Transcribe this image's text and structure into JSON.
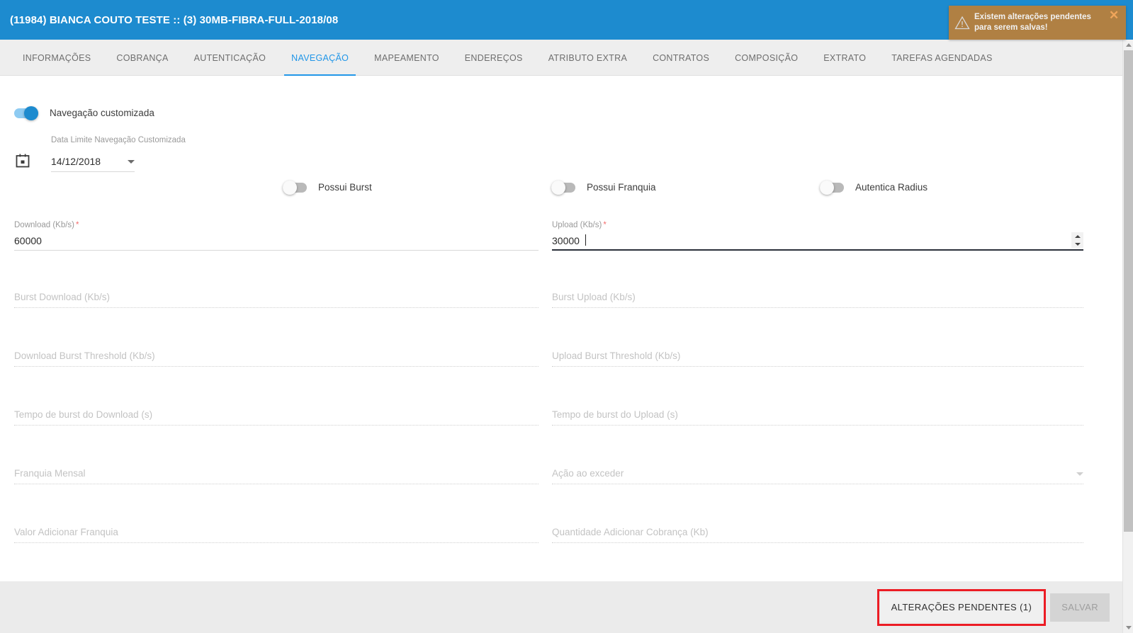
{
  "header": {
    "title": "(11984) BIANCA COUTO TESTE :: (3) 30MB-FIBRA-FULL-2018/08",
    "bg_color": "#1d8bcf"
  },
  "toast": {
    "message": "Existem alterações pendentes para serem salvas!",
    "close_label": "✕",
    "icon": "warning-triangle-icon",
    "bg_color": "#b08043"
  },
  "tabs": [
    {
      "label": "INFORMAÇÕES",
      "active": false
    },
    {
      "label": "COBRANÇA",
      "active": false
    },
    {
      "label": "AUTENTICAÇÃO",
      "active": false
    },
    {
      "label": "NAVEGAÇÃO",
      "active": true
    },
    {
      "label": "MAPEAMENTO",
      "active": false
    },
    {
      "label": "ENDEREÇOS",
      "active": false
    },
    {
      "label": "ATRIBUTO EXTRA",
      "active": false
    },
    {
      "label": "CONTRATOS",
      "active": false
    },
    {
      "label": "COMPOSIÇÃO",
      "active": false
    },
    {
      "label": "EXTRATO",
      "active": false
    },
    {
      "label": "TAREFAS AGENDADAS",
      "active": false
    }
  ],
  "active_tab_color": "#2196e8",
  "form": {
    "nav_toggle": {
      "label": "Navegação customizada",
      "on": true
    },
    "date": {
      "label": "Data Limite Navegação Customizada",
      "value": "14/12/2018",
      "icon": "calendar-icon"
    },
    "toggles": [
      {
        "label": "Possui Burst",
        "on": false
      },
      {
        "label": "Possui Franquia",
        "on": false
      },
      {
        "label": "Autentica Radius",
        "on": false
      }
    ],
    "download": {
      "label": "Download (Kb/s)",
      "required": "*",
      "value": "60000"
    },
    "upload": {
      "label": "Upload (Kb/s)",
      "required": "*",
      "value": "30000"
    },
    "disabled_fields": [
      {
        "placeholder": "Burst Download (Kb/s)",
        "col": "left",
        "dropdown": false
      },
      {
        "placeholder": "Burst Upload (Kb/s)",
        "col": "right",
        "dropdown": false
      },
      {
        "placeholder": "Download Burst Threshold (Kb/s)",
        "col": "left",
        "dropdown": false
      },
      {
        "placeholder": "Upload Burst Threshold (Kb/s)",
        "col": "right",
        "dropdown": false
      },
      {
        "placeholder": "Tempo de burst do Download (s)",
        "col": "left",
        "dropdown": false
      },
      {
        "placeholder": "Tempo de burst do Upload (s)",
        "col": "right",
        "dropdown": false
      },
      {
        "placeholder": "Franquia Mensal",
        "col": "left",
        "dropdown": false
      },
      {
        "placeholder": "Ação ao exceder",
        "col": "right",
        "dropdown": true
      },
      {
        "placeholder": "Valor Adicionar Franquia",
        "col": "left",
        "dropdown": false
      },
      {
        "placeholder": "Quantidade Adicionar Cobrança (Kb)",
        "col": "right",
        "dropdown": false
      }
    ]
  },
  "footer": {
    "pending_button": "ALTERAÇÕES PENDENTES (1)",
    "save_button": "SALVAR",
    "highlight_color": "#ec1c24"
  }
}
